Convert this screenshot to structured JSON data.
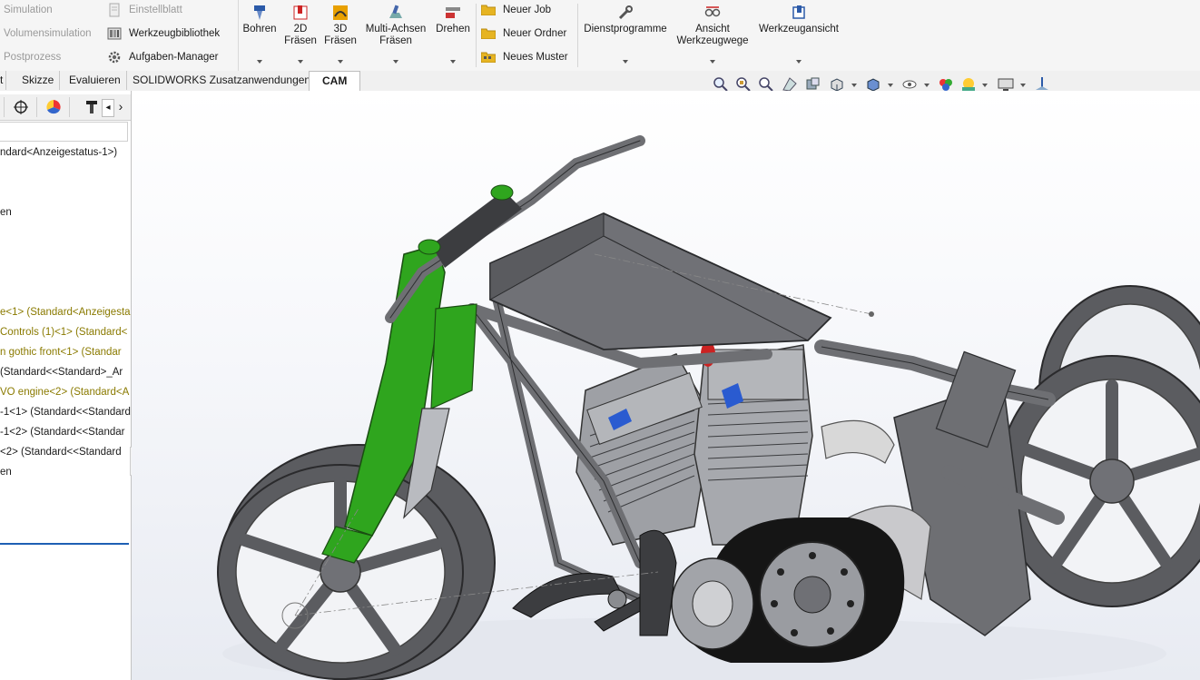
{
  "ribbon": {
    "left_menu": [
      {
        "label": "Simulation",
        "dim": true
      },
      {
        "label": "Einstellblatt",
        "dim": true
      },
      {
        "label": "Volumensimulation",
        "dim": true
      },
      {
        "label": "Werkzeugbibliothek",
        "dim": false
      },
      {
        "label": "Postprozess",
        "dim": true
      },
      {
        "label": "Aufgaben-Manager",
        "dim": false
      }
    ],
    "cam_buttons": [
      {
        "line1": "Bohren",
        "line2": ""
      },
      {
        "line1": "2D",
        "line2": "Fräsen"
      },
      {
        "line1": "3D",
        "line2": "Fräsen"
      },
      {
        "line1": "Multi-Achsen",
        "line2": "Fräsen"
      },
      {
        "line1": "Drehen",
        "line2": ""
      }
    ],
    "job_menu": [
      "Neuer Job",
      "Neuer Ordner",
      "Neues Muster"
    ],
    "tool_buttons": [
      {
        "line1": "Dienstprogramme",
        "line2": ""
      },
      {
        "line1": "Ansicht",
        "line2": "Werkzeugwege"
      },
      {
        "line1": "Werkzeugansicht",
        "line2": ""
      }
    ]
  },
  "tabs": [
    {
      "label": "t",
      "active": false
    },
    {
      "label": "Skizze",
      "active": false
    },
    {
      "label": "Evaluieren",
      "active": false
    },
    {
      "label": "SOLIDWORKS Zusatzanwendungen",
      "active": false
    },
    {
      "label": "CAM",
      "active": true
    }
  ],
  "panel": {
    "tree": [
      {
        "text": "ndard<Anzeigestatus-1>)",
        "color": "black"
      },
      {
        "text": "en",
        "color": "black"
      },
      {
        "text": "e<1> (Standard<Anzeigesta",
        "color": "olive"
      },
      {
        "text": " Controls (1)<1> (Standard<",
        "color": "olive"
      },
      {
        "text": "n gothic front<1> (Standar",
        "color": "olive"
      },
      {
        "text": " (Standard<<Standard>_Ar",
        "color": "black"
      },
      {
        "text": "VO engine<2> (Standard<A",
        "color": "olive"
      },
      {
        "text": "-1<1> (Standard<<Standard",
        "color": "black"
      },
      {
        "text": "-1<2> (Standard<<Standar",
        "color": "black"
      },
      {
        "text": " <2> (Standard<<Standard",
        "color": "black"
      },
      {
        "text": "en",
        "color": "black"
      }
    ]
  },
  "colors": {
    "frame": "#6e6f73",
    "frame_dark": "#3c3d40",
    "fork_green": "#2fa51e",
    "engine": "#9ea0a5",
    "wheel": "#5b5c60",
    "belt": "#151515",
    "accent_blue": "#1e5fb4"
  }
}
